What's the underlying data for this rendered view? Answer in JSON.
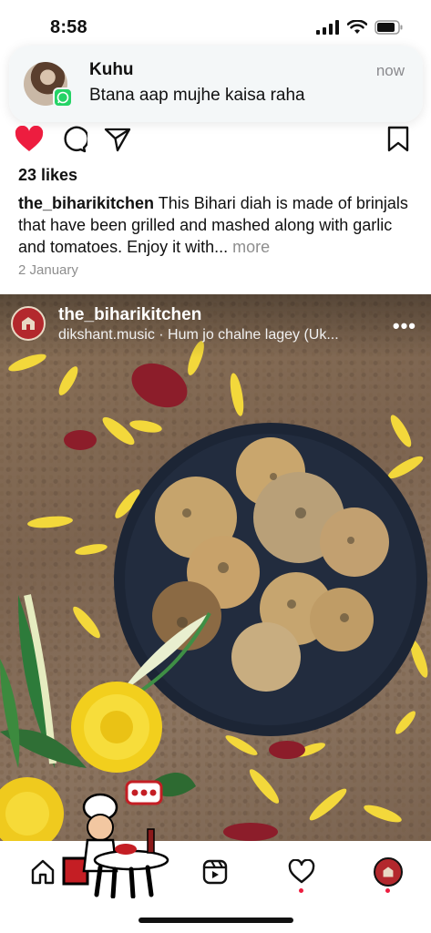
{
  "status_bar": {
    "time": "8:58"
  },
  "notification": {
    "sender": "Kuhu",
    "message": "Btana aap mujhe kaisa raha",
    "time": "now",
    "app_icon": "whatsapp-icon"
  },
  "post": {
    "likes": "23 likes",
    "username": "the_biharikitchen",
    "caption": "This Bihari diah is made of brinjals that have been grilled and mashed along with garlic and tomatoes. Enjoy it with...",
    "more_label": "more",
    "date": "2 January",
    "liked": true
  },
  "reel": {
    "username": "the_biharikitchen",
    "music": "dikshant.music · Hum jo chalne lagey (Uk...",
    "more_label": "•••"
  },
  "nav": {
    "items": [
      "home-icon",
      "reels-icon",
      "activity-heart-icon",
      "profile-avatar"
    ]
  },
  "colors": {
    "like_red": "#ed1d3f",
    "brand_red": "#b3282d",
    "whatsapp_green": "#25d366"
  }
}
